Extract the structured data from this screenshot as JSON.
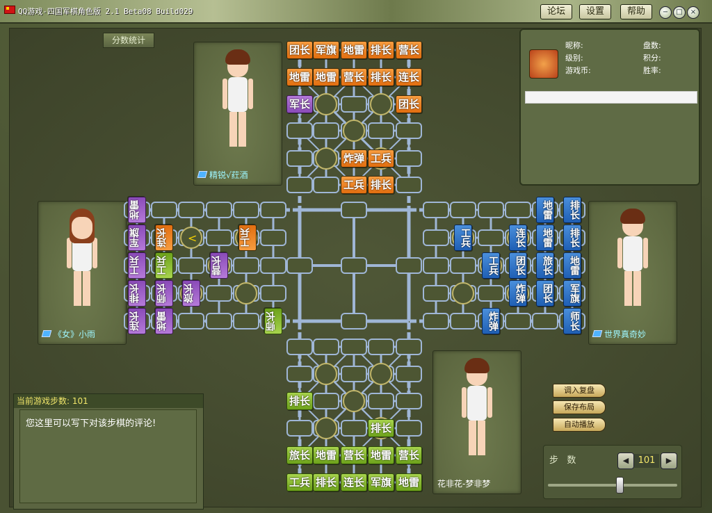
{
  "window": {
    "title": "QQ游戏-四国军棋角色版 2.1 Beta08 Build029",
    "buttons": {
      "forum": "论坛",
      "settings": "设置",
      "help": "帮助"
    },
    "controls": {
      "minimize": "−",
      "restore": "□",
      "close": "×"
    }
  },
  "tabs": {
    "score_stats": "分数统计"
  },
  "players": {
    "top": {
      "name": "精锐√荭酒"
    },
    "left": {
      "name": "《女》小雨"
    },
    "right": {
      "name": "世界真奇妙"
    },
    "bottom": {
      "name": "花非花-梦非梦"
    }
  },
  "info_panel": {
    "nickname_label": "昵称:",
    "games_label": "盘数:",
    "level_label": "级别:",
    "score_label": "积分:",
    "coins_label": "游戏币:",
    "winrate_label": "胜率:"
  },
  "step_panel": {
    "header": "当前游戏步数: 101",
    "comment_placeholder": "您这里可以写下对该步棋的评论!"
  },
  "replay_buttons": {
    "load": "调入复盘",
    "save": "保存布局",
    "auto": "自动播放"
  },
  "step_control": {
    "label": "步   数",
    "value": "101",
    "slider_fraction": 0.55
  },
  "pieces": {
    "top_orange": [
      [
        "团长",
        "军旗",
        "地雷",
        "排长",
        "营长"
      ],
      [
        "地雷",
        "地雷",
        "营长",
        "排长",
        "连长"
      ],
      [
        "军长",
        "",
        "",
        "",
        "团长"
      ],
      [
        "",
        "",
        "",
        "",
        ""
      ],
      [
        "",
        "",
        "炸弹",
        "工兵",
        ""
      ],
      [
        "",
        "",
        "工兵",
        "排长",
        ""
      ]
    ],
    "top_purple": "军长",
    "bottom_green": [
      [
        "工兵",
        "排长",
        "连长",
        "军旗",
        "地雷"
      ],
      [
        "旅长",
        "地雷",
        "营长",
        "地雷",
        "营长"
      ],
      [
        "排长"
      ],
      [
        "排长"
      ]
    ],
    "left_purple": [
      "地雷",
      "军旗",
      "工兵",
      "排长",
      "连长"
    ],
    "left_mixed": [
      {
        "label": "连长",
        "color": "orange"
      },
      {
        "label": "工兵",
        "color": "orange"
      },
      {
        "label": "工兵",
        "color": "green"
      },
      {
        "label": "营长",
        "color": "purple"
      },
      {
        "label": "师长",
        "color": "purple"
      },
      {
        "label": "旅长",
        "color": "purple"
      },
      {
        "label": "地雷",
        "color": "purple"
      },
      {
        "label": "师长",
        "color": "green"
      }
    ],
    "right_blue_col1": [
      "排长",
      "排长",
      "地雷",
      "军旗",
      "师长"
    ],
    "right_blue_col2": [
      "地雷",
      "地雷",
      "旅长",
      "团长"
    ],
    "right_blue_mid": [
      {
        "label": "工兵"
      },
      {
        "label": "连长"
      },
      {
        "label": "团长"
      },
      {
        "label": "炸弹"
      },
      {
        "label": "工兵"
      },
      {
        "label": "炸弹"
      }
    ]
  },
  "colors": {
    "orange": "#e87a1f",
    "purple": "#9a5cc6",
    "green": "#7cb42a",
    "blue": "#2a6dc4",
    "track": "#9fb6d6"
  }
}
